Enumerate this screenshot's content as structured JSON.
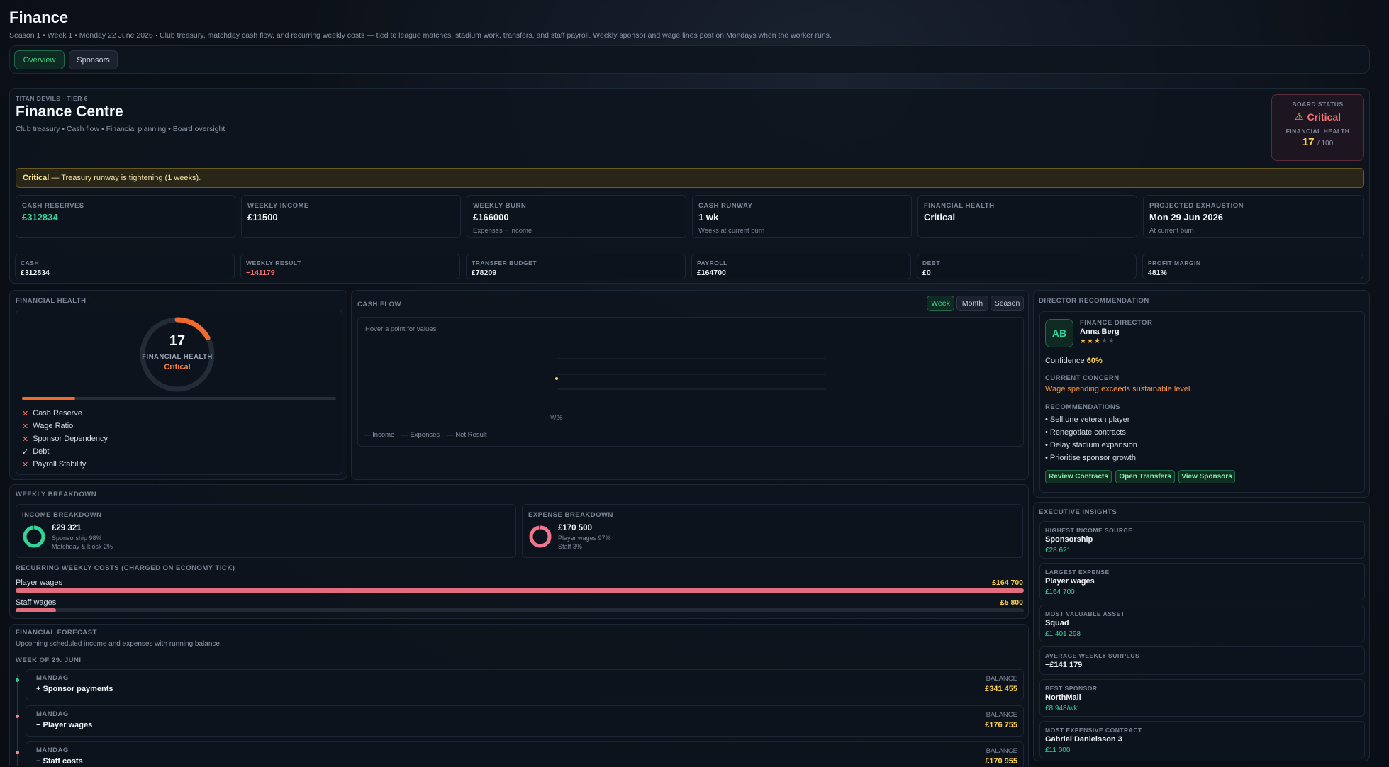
{
  "header": {
    "title": "Finance",
    "subtitle": "Season 1 • Week 1 • Monday 22 June 2026 · Club treasury, matchday cash flow, and recurring weekly costs — tied to league matches, stadium work, transfers, and staff payroll. Weekly sponsor and wage lines post on Mondays when the worker runs.",
    "tabs": [
      "Overview",
      "Sponsors"
    ]
  },
  "centre": {
    "club_line": "TITAN DEVILS · TIER 6",
    "title": "Finance Centre",
    "subtitle": "Club treasury • Cash flow • Financial planning • Board oversight",
    "board_status_label": "BOARD STATUS",
    "board_status": "Critical",
    "health_label": "FINANCIAL HEALTH",
    "health_value": "17",
    "health_max": "/ 100",
    "alert_strong": "Critical",
    "alert_text": " — Treasury runway is tightening (1 weeks)."
  },
  "kpis": [
    {
      "label": "CASH RESERVES",
      "value": "£312834",
      "note": ""
    },
    {
      "label": "WEEKLY INCOME",
      "value": "£11500",
      "note": ""
    },
    {
      "label": "WEEKLY BURN",
      "value": "£166000",
      "note": "Expenses − income"
    },
    {
      "label": "CASH RUNWAY",
      "value": "1 wk",
      "note": "Weeks at current burn"
    },
    {
      "label": "FINANCIAL HEALTH",
      "value": "Critical",
      "note": ""
    },
    {
      "label": "PROJECTED EXHAUSTION",
      "value": "Mon 29 Jun 2026",
      "note": "At current burn"
    }
  ],
  "mini": [
    {
      "label": "CASH",
      "value": "£312834"
    },
    {
      "label": "WEEKLY RESULT",
      "value": "−141179"
    },
    {
      "label": "TRANSFER BUDGET",
      "value": "£78209"
    },
    {
      "label": "PAYROLL",
      "value": "£164700"
    },
    {
      "label": "DEBT",
      "value": "£0"
    },
    {
      "label": "PROFIT MARGIN",
      "value": "481%"
    }
  ],
  "health": {
    "heading": "FINANCIAL HEALTH",
    "score": "17",
    "score_fraction": 0.17,
    "ring_label": "FINANCIAL HEALTH",
    "status": "Critical",
    "checks": [
      {
        "label": "Cash Reserve",
        "ok": false
      },
      {
        "label": "Wage Ratio",
        "ok": false
      },
      {
        "label": "Sponsor Dependency",
        "ok": false
      },
      {
        "label": "Debt",
        "ok": true
      },
      {
        "label": "Payroll Stability",
        "ok": false
      }
    ],
    "check_ok_icon": "✓",
    "check_fail_icon": "✕"
  },
  "cashflow": {
    "heading": "CASH FLOW",
    "ranges": [
      "Week",
      "Month",
      "Season"
    ],
    "hint": "Hover a point for values",
    "legend": [
      "Income",
      "Expenses",
      "Net Result"
    ]
  },
  "chart_data": {
    "type": "line",
    "x": [
      "W26"
    ],
    "series": [
      {
        "name": "Income",
        "values": [
          11500
        ]
      },
      {
        "name": "Expenses",
        "values": [
          166000
        ]
      },
      {
        "name": "Net Result",
        "values": [
          -141179
        ]
      }
    ],
    "colors": {
      "Income": "#34d399",
      "Expenses": "#f08ca0",
      "Net Result": "#fcd34d"
    }
  },
  "director": {
    "heading": "DIRECTOR RECOMMENDATION",
    "initials": "AB",
    "role": "FINANCE DIRECTOR",
    "name": "Anna Berg",
    "stars": 3,
    "stars_max": 5,
    "confidence_label": "Confidence",
    "confidence": "60%",
    "concern_label": "CURRENT CONCERN",
    "concern": "Wage spending exceeds sustainable level.",
    "rec_label": "RECOMMENDATIONS",
    "recommendations": [
      "• Sell one veteran player",
      "• Renegotiate contracts",
      "• Delay stadium expansion",
      "• Prioritise sponsor growth"
    ],
    "actions": [
      "Review Contracts",
      "Open Transfers",
      "View Sponsors"
    ]
  },
  "weekly": {
    "heading": "WEEKLY BREAKDOWN",
    "income_label": "INCOME BREAKDOWN",
    "income_total": "£29 321",
    "income_lines": [
      "Sponsorship 98%",
      "Matchday & kiosk 2%"
    ],
    "income_share": 0.98,
    "expense_label": "EXPENSE BREAKDOWN",
    "expense_total": "£170 500",
    "expense_lines": [
      "Player wages 97%",
      "Staff 3%"
    ],
    "expense_share": 0.97,
    "recurring_label": "RECURRING WEEKLY COSTS (CHARGED ON ECONOMY TICK)",
    "costs": [
      {
        "label": "Player wages",
        "value": "£164 700",
        "fraction": 1.0
      },
      {
        "label": "Staff wages",
        "value": "£5 800",
        "fraction": 0.04
      }
    ]
  },
  "forecast": {
    "heading": "FINANCIAL FORECAST",
    "subtitle": "Upcoming scheduled income and expenses with running balance.",
    "week_label": "WEEK OF 29. JUNI",
    "balance_label": "BALANCE",
    "items": [
      {
        "day": "MANDAG",
        "label": "+ Sponsor payments",
        "balance": "£341 455",
        "dot": "#34d399"
      },
      {
        "day": "MANDAG",
        "label": "− Player wages",
        "balance": "£176 755",
        "dot": "#f08ca0"
      },
      {
        "day": "MANDAG",
        "label": "− Staff costs",
        "balance": "£170 955",
        "dot": "#f08ca0"
      }
    ]
  },
  "insights": {
    "heading": "EXECUTIVE INSIGHTS",
    "items": [
      {
        "label": "HIGHEST INCOME SOURCE",
        "title": "Sponsorship",
        "value": "£28 621"
      },
      {
        "label": "LARGEST EXPENSE",
        "title": "Player wages",
        "value": "£164 700"
      },
      {
        "label": "MOST VALUABLE ASSET",
        "title": "Squad",
        "value": "£1 401 298"
      },
      {
        "label": "AVERAGE WEEKLY SURPLUS",
        "title": "−£141 179",
        "value": ""
      },
      {
        "label": "BEST SPONSOR",
        "title": "NorthMall",
        "value": "£8 948/wk"
      },
      {
        "label": "MOST EXPENSIVE CONTRACT",
        "title": "Gabriel Danielsson 3",
        "value": "£11 000"
      }
    ]
  },
  "icons": {
    "warning": "warning-icon",
    "star": "star-icon"
  }
}
